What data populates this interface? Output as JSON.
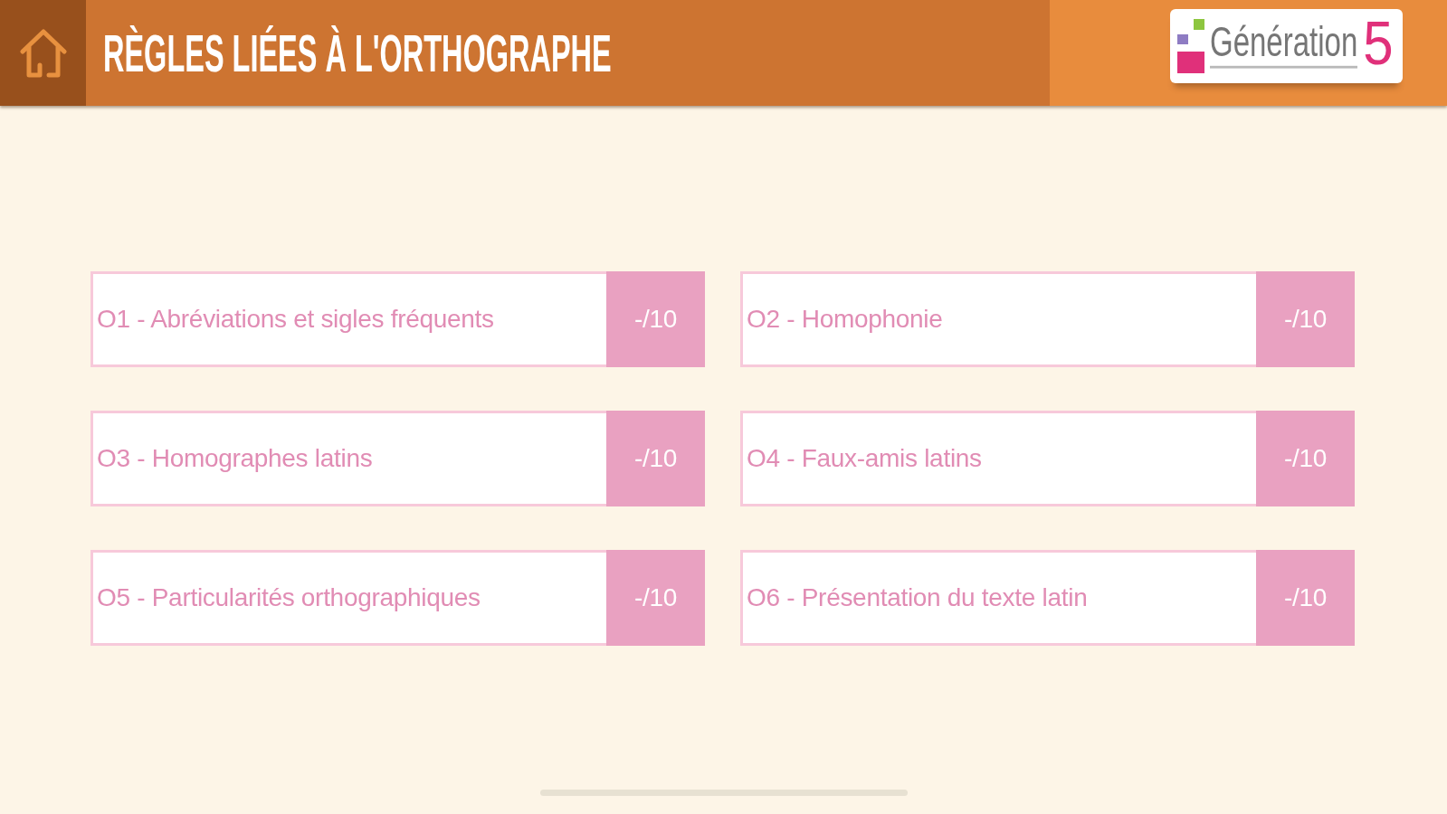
{
  "header": {
    "title": "RÈGLES LIÉES À L'ORTHOGRAPHE",
    "logo": {
      "wordmark": "Génération",
      "number": "5"
    }
  },
  "lessons": [
    {
      "label": "O1 - Abréviations et sigles fréquents",
      "score": "-/10"
    },
    {
      "label": "O2 - Homophonie",
      "score": "-/10"
    },
    {
      "label": "O3 - Homographes latins",
      "score": "-/10"
    },
    {
      "label": "O4 - Faux-amis latins",
      "score": "-/10"
    },
    {
      "label": "O5 - Particularités orthographiques",
      "score": "-/10"
    },
    {
      "label": "O6 - Présentation du texte latin",
      "score": "-/10"
    }
  ]
}
